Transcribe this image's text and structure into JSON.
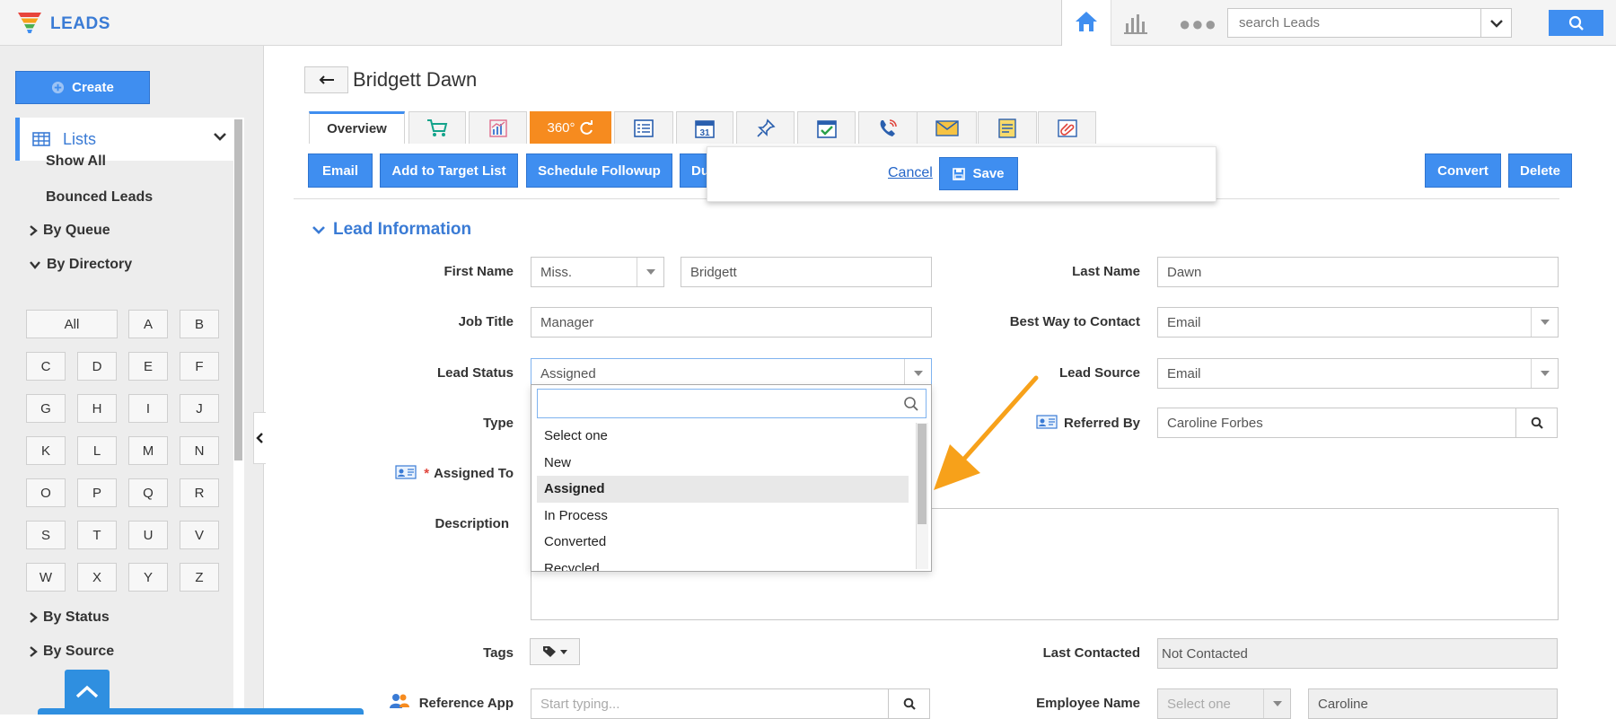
{
  "app": {
    "title": "LEADS"
  },
  "topbar": {
    "search_placeholder": "search Leads"
  },
  "sidebar": {
    "create_label": "Create",
    "lists_label": "Lists",
    "links": [
      "Show All",
      "Bounced Leads"
    ],
    "groups": {
      "by_queue": "By Queue",
      "by_directory": "By Directory",
      "by_status": "By Status",
      "by_source": "By Source"
    },
    "letters": [
      "All",
      "A",
      "B",
      "C",
      "D",
      "E",
      "F",
      "G",
      "H",
      "I",
      "J",
      "K",
      "L",
      "M",
      "N",
      "O",
      "P",
      "Q",
      "R",
      "S",
      "T",
      "U",
      "V",
      "W",
      "X",
      "Y",
      "Z"
    ]
  },
  "page": {
    "title": "Bridgett Dawn"
  },
  "tabs": {
    "overview": "Overview",
    "t360": "360°"
  },
  "actions": {
    "email": "Email",
    "add_target": "Add to Target List",
    "schedule": "Schedule Followup",
    "du": "Du",
    "convert": "Convert",
    "delete": "Delete"
  },
  "save_popup": {
    "cancel": "Cancel",
    "save": "Save"
  },
  "section": {
    "title": "Lead Information"
  },
  "form": {
    "first_name_label": "First Name",
    "salutation": "Miss.",
    "first_name": "Bridgett",
    "last_name_label": "Last Name",
    "last_name": "Dawn",
    "job_title_label": "Job Title",
    "job_title": "Manager",
    "best_way_label": "Best Way to Contact",
    "best_way": "Email",
    "lead_status_label": "Lead Status",
    "lead_status": "Assigned",
    "lead_source_label": "Lead Source",
    "lead_source": "Email",
    "type_label": "Type",
    "referred_by_label": "Referred By",
    "referred_by": "Caroline Forbes",
    "assigned_to_label": "Assigned To",
    "required_mark": "*",
    "description_label": "Description",
    "tags_label": "Tags",
    "last_contacted_label": "Last Contacted",
    "last_contacted": "Not Contacted",
    "reference_app_label": "Reference App",
    "reference_app_placeholder": "Start typing...",
    "employee_name_label": "Employee Name",
    "employee_select": "Select one",
    "employee_name": "Caroline"
  },
  "status_dropdown": {
    "options": [
      "Select one",
      "New",
      "Assigned",
      "In Process",
      "Converted",
      "Recycled"
    ],
    "selected_index": 2
  },
  "colors": {
    "accent": "#3f8ef0",
    "brand_text": "#3a7bd5",
    "tab360": "#f68b1f",
    "annotation_arrow": "#f7a11a"
  }
}
